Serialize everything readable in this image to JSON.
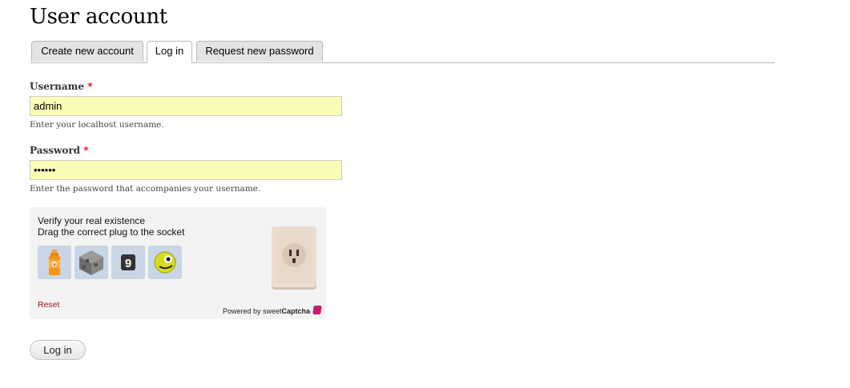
{
  "page": {
    "title": "User account"
  },
  "tabs": [
    {
      "label": "Create new account",
      "active": false
    },
    {
      "label": "Log in",
      "active": true
    },
    {
      "label": "Request new password",
      "active": false
    }
  ],
  "form": {
    "username": {
      "label": "Username",
      "required_mark": "*",
      "value": "admin",
      "description": "Enter your localhost username."
    },
    "password": {
      "label": "Password",
      "required_mark": "*",
      "value": "••••••",
      "description": "Enter the password that accompanies your username."
    },
    "submit_label": "Log in"
  },
  "captcha": {
    "line1": "Verify your real existence",
    "line2": "Drag the correct plug to the socket",
    "options": [
      "bottle-icon",
      "cube-icon",
      "number-nine-icon",
      "yellow-face-icon"
    ],
    "reset_label": "Reset",
    "powered_prefix": "Powered by ",
    "brand_sweet": "sweet",
    "brand_captcha": "Captcha"
  },
  "colors": {
    "input_bg": "#fbfdb6",
    "required": "#e00000",
    "reset_link": "#a0141e",
    "brand": "#d0196b"
  }
}
